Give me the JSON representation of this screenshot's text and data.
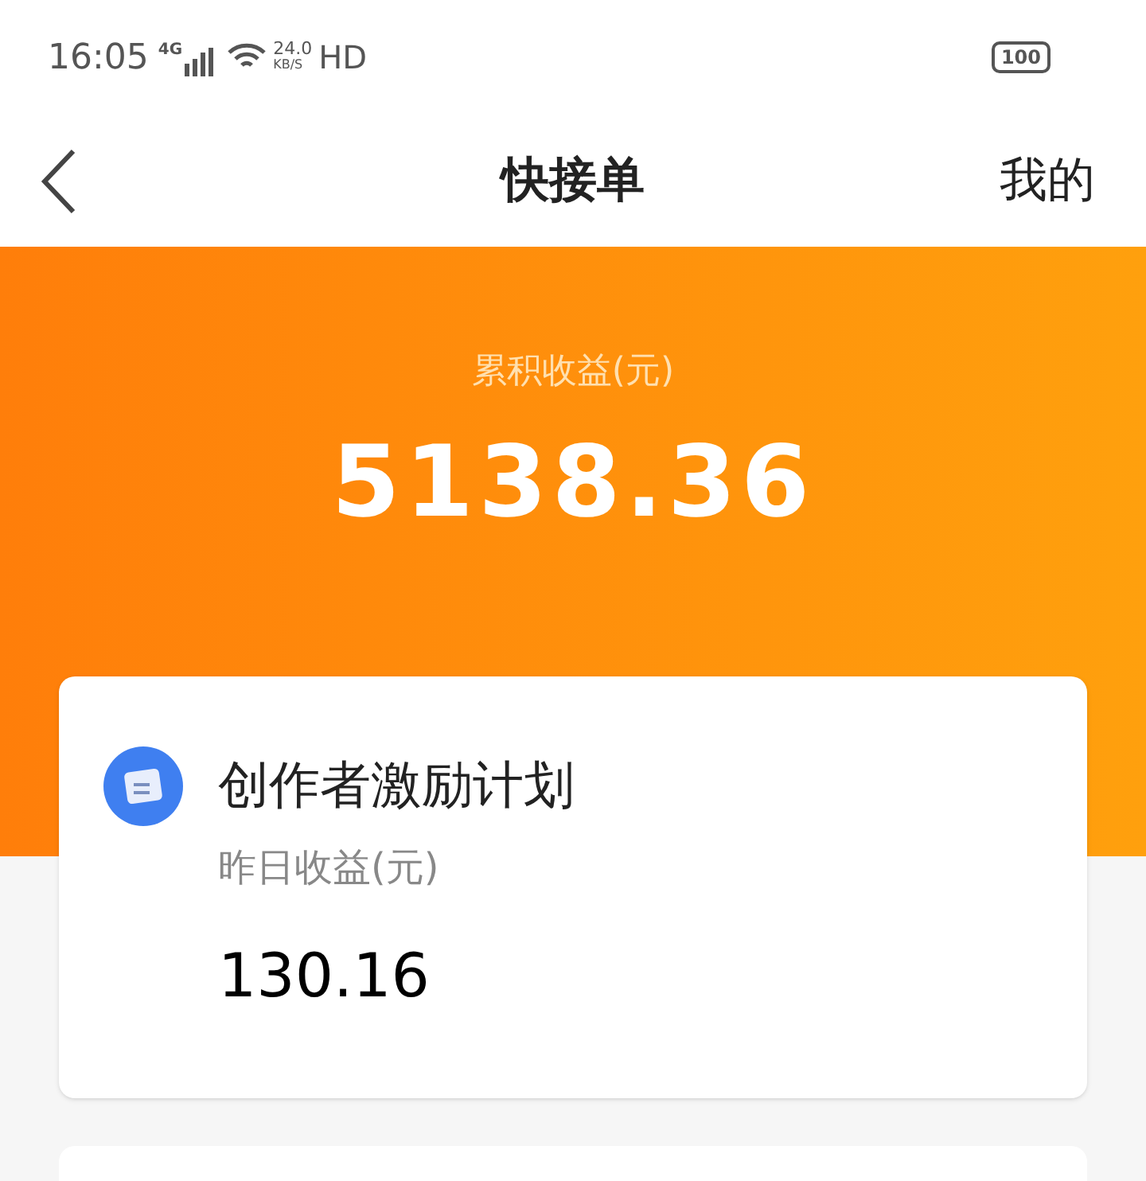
{
  "status_bar": {
    "time": "16:05",
    "network": "4G",
    "speed_value": "24.0",
    "speed_unit": "KB/S",
    "hd": "HD",
    "battery": "100"
  },
  "header": {
    "title": "快接单",
    "right_link": "我的"
  },
  "summary": {
    "label": "累积收益(元)",
    "amount": "5138.36"
  },
  "cards": [
    {
      "title": "创作者激励计划",
      "label": "昨日收益(元)",
      "value": "130.16"
    }
  ]
}
